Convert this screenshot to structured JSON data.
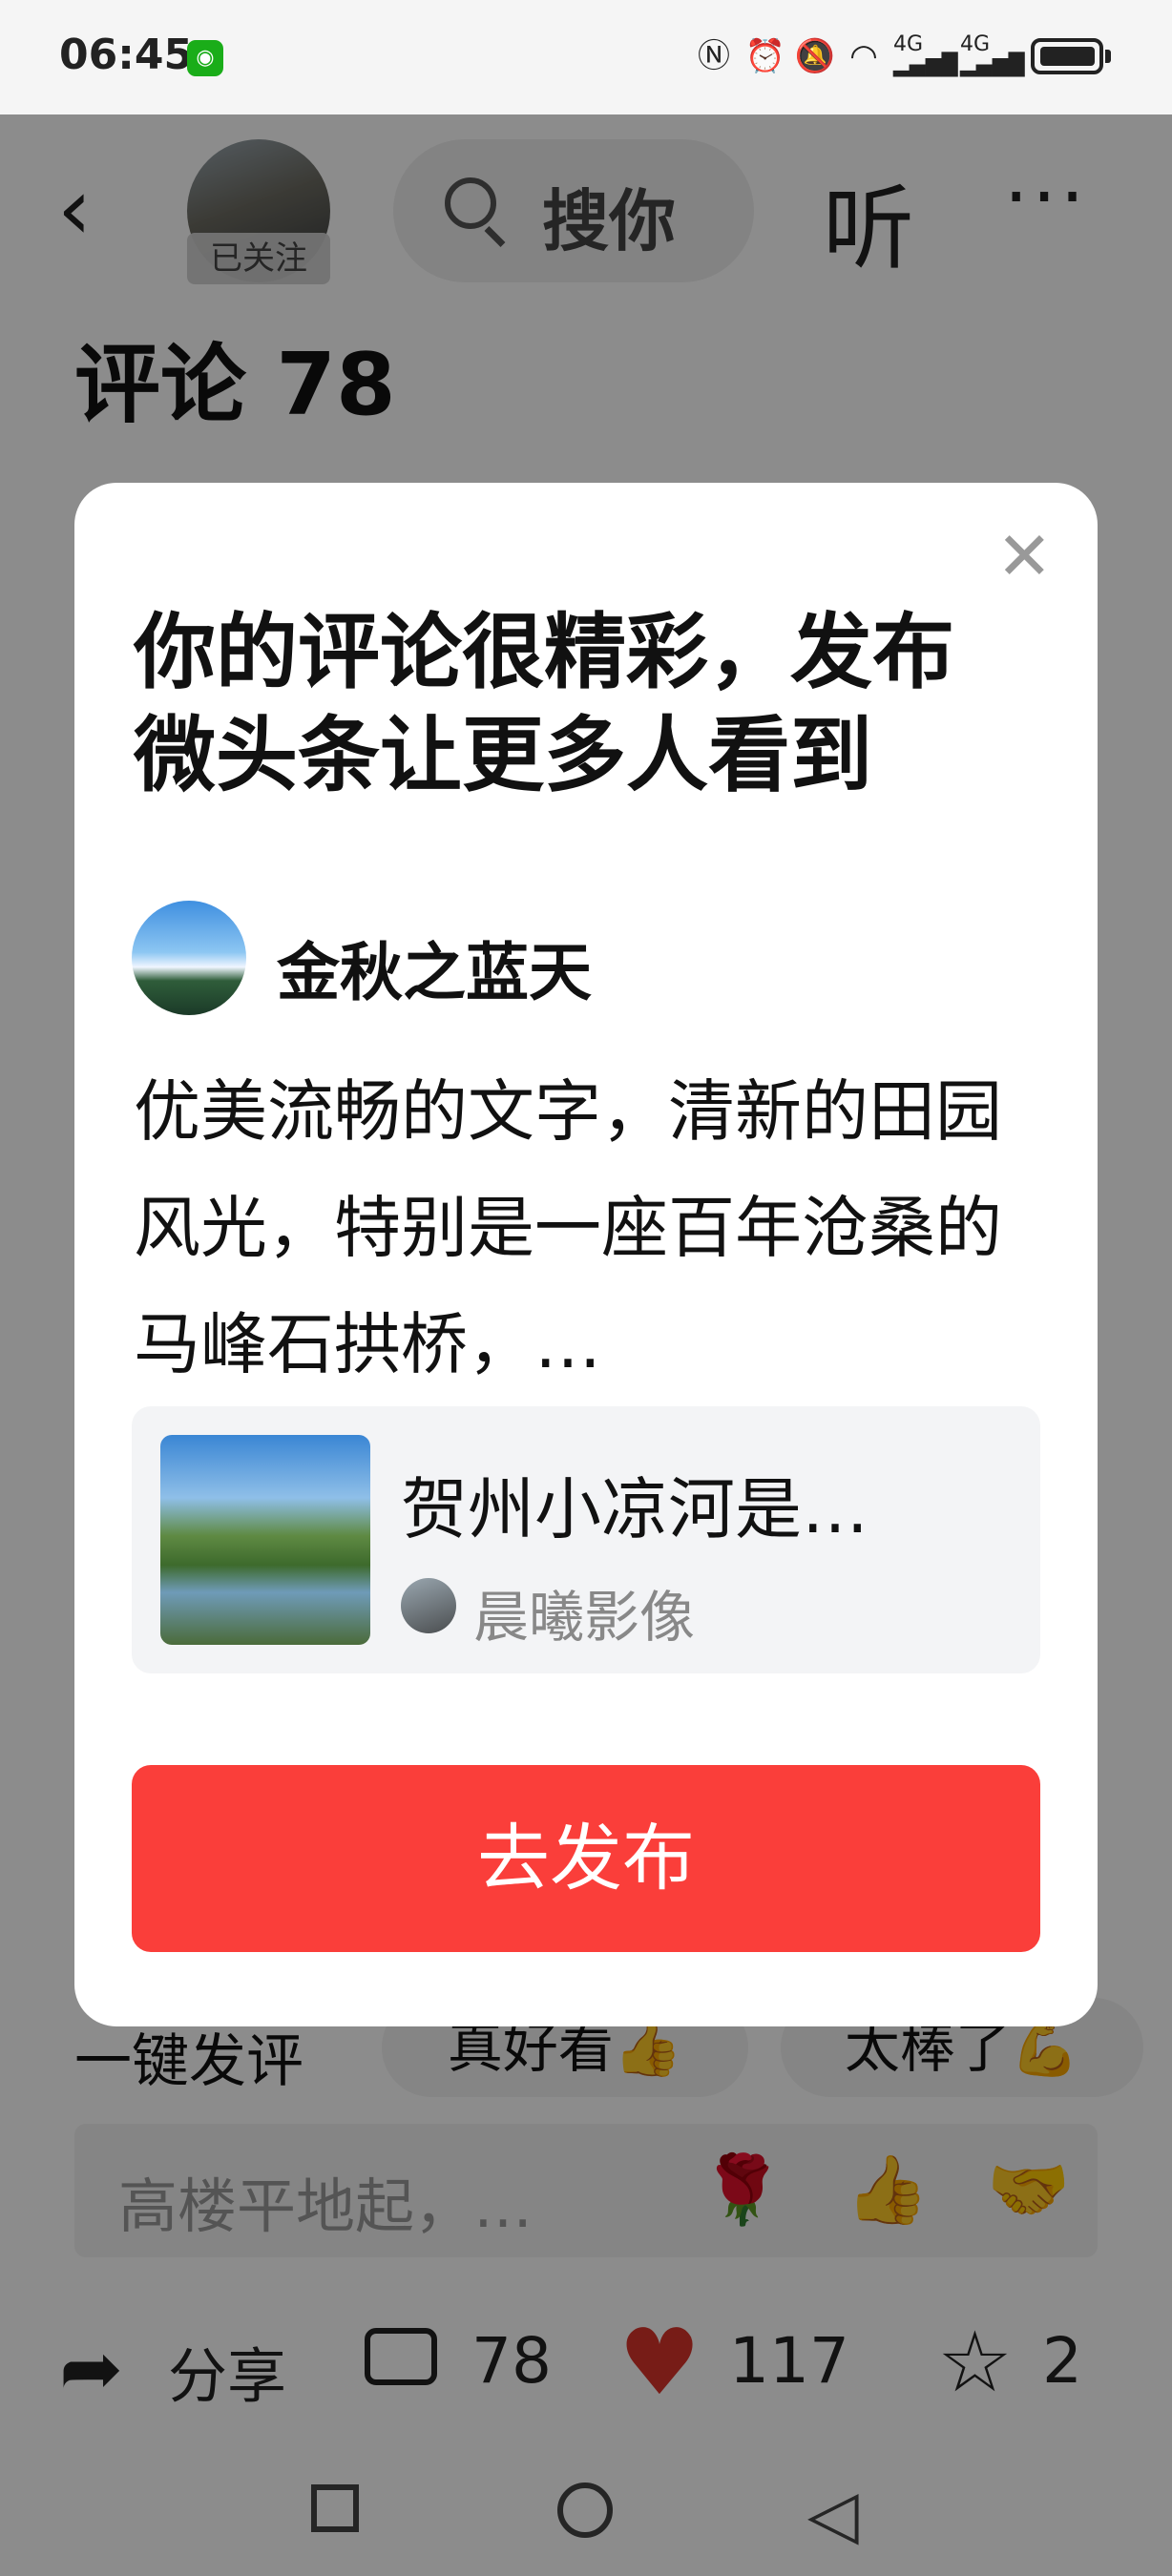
{
  "status_bar": {
    "time": "06:45",
    "icons": [
      "wechat-icon",
      "nfc-icon",
      "alarm-icon",
      "mute-icon",
      "wifi-icon",
      "signal-4g-icon",
      "signal-4g-icon",
      "battery-icon"
    ],
    "battery_level": 0.95,
    "network_label_1": "4G",
    "network_label_2": "4G"
  },
  "header": {
    "follow_badge": "已关注",
    "search_text": "搜你",
    "listen_label": "听",
    "more_label": "···"
  },
  "comments_title": "评论 78",
  "modal": {
    "title": "你的评论很精彩，发布微头条让更多人看到",
    "commenter_name": "金秋之蓝天",
    "comment_text": "优美流畅的文字，清新的田园风光，特别是一座百年沧桑的马峰石拱桥，…",
    "article_title": "贺州小凉河是…",
    "article_author": "晨曦影像",
    "publish_button": "去发布"
  },
  "quick_reply": {
    "label": "一键发评",
    "chips": [
      "真好看👍",
      "太棒了💪"
    ]
  },
  "comment_input": {
    "placeholder": "高楼平地起，…",
    "emojis": [
      "🌹",
      "👍",
      "🤝"
    ]
  },
  "action_bar": {
    "share_label": "分享",
    "comment_count": "78",
    "like_count": "117",
    "favorite_count": "2"
  }
}
